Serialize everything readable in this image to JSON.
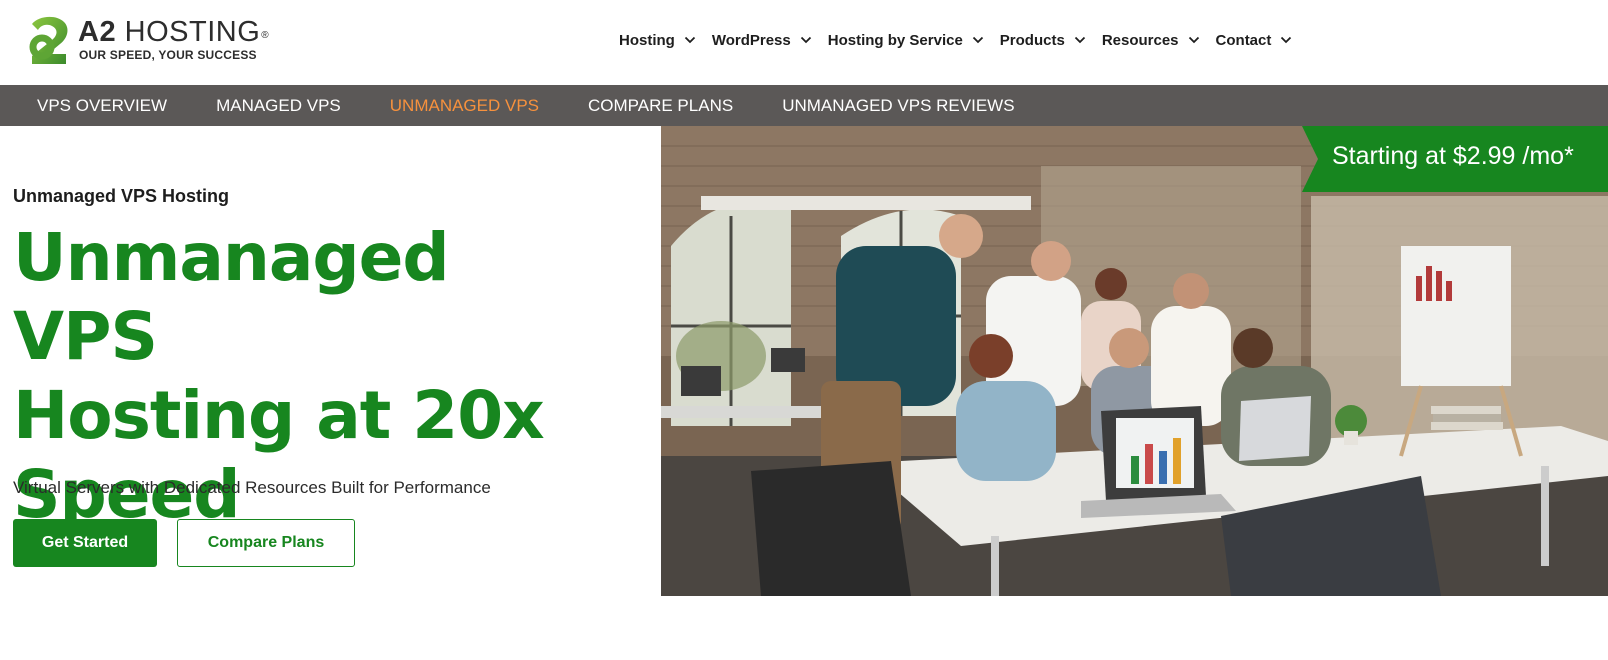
{
  "brand": {
    "name_bold": "A2",
    "name_thin": "HOSTING",
    "registered": "®",
    "tagline": "OUR SPEED, YOUR SUCCESS",
    "accent_color": "#17861f"
  },
  "main_nav": [
    {
      "label": "Hosting",
      "icon": "chevron-down-icon"
    },
    {
      "label": "WordPress",
      "icon": "chevron-down-icon"
    },
    {
      "label": "Hosting by Service",
      "icon": "chevron-down-icon"
    },
    {
      "label": "Products",
      "icon": "chevron-down-icon"
    },
    {
      "label": "Resources",
      "icon": "chevron-down-icon"
    },
    {
      "label": "Contact",
      "icon": "chevron-down-icon"
    }
  ],
  "sub_nav": {
    "items": [
      {
        "label": "VPS OVERVIEW",
        "active": false
      },
      {
        "label": "MANAGED VPS",
        "active": false
      },
      {
        "label": "UNMANAGED VPS",
        "active": true
      },
      {
        "label": "COMPARE PLANS",
        "active": false
      },
      {
        "label": "UNMANAGED VPS REVIEWS",
        "active": false
      }
    ],
    "background": "#5b5857",
    "active_color": "#f7913d"
  },
  "hero": {
    "eyebrow": "Unmanaged VPS Hosting",
    "title_lines": [
      "Unmanaged VPS",
      "Hosting at 20x",
      "Speed"
    ],
    "subtitle": "Virtual Servers with Dedicated Resources Built for Performance",
    "primary_button": "Get Started",
    "secondary_button": "Compare Plans",
    "price_badge": "Starting at $2.99 /mo*"
  }
}
